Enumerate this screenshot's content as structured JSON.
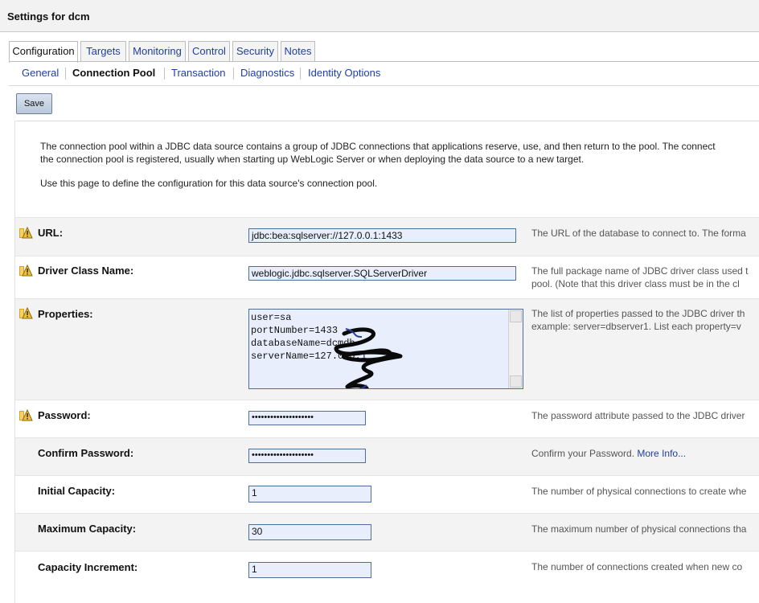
{
  "header": {
    "title": "Settings for dcm"
  },
  "tabs": [
    {
      "label": "Configuration",
      "active": true
    },
    {
      "label": "Targets",
      "active": false
    },
    {
      "label": "Monitoring",
      "active": false
    },
    {
      "label": "Control",
      "active": false
    },
    {
      "label": "Security",
      "active": false
    },
    {
      "label": "Notes",
      "active": false
    }
  ],
  "subtabs": [
    {
      "label": "General",
      "active": false
    },
    {
      "label": "Connection Pool",
      "active": true
    },
    {
      "label": "Transaction",
      "active": false
    },
    {
      "label": "Diagnostics",
      "active": false
    },
    {
      "label": "Identity Options",
      "active": false
    }
  ],
  "toolbar": {
    "save_label": "Save"
  },
  "intro": {
    "line1": "The connection pool within a JDBC data source contains a group of JDBC connections that applications reserve, use, and then return to the pool. The connect",
    "line2": "the connection pool is registered, usually when starting up WebLogic Server or when deploying the data source to a new target.",
    "line3": "Use this page to define the configuration for this data source's connection pool."
  },
  "fields": {
    "url": {
      "label": "URL:",
      "value": "jdbc:bea:sqlserver://127.0.0.1:1433",
      "desc": "The URL of the database to connect to. The forma"
    },
    "driver": {
      "label": "Driver Class Name:",
      "value": "weblogic.jdbc.sqlserver.SQLServerDriver",
      "desc1": "The full package name of JDBC driver class used t",
      "desc2": "pool. (Note that this driver class must be in the cl"
    },
    "properties": {
      "label": "Properties:",
      "lines": "user=sa\nportNumber=1433\ndatabaseName=dcmdb\nserverName=127.0.0.1",
      "desc1": "The list of properties passed to the JDBC driver th",
      "desc2": "example: server=dbserver1. List each property=v"
    },
    "password": {
      "label": "Password:",
      "value": "••••••••••••••••••••",
      "desc": "The password attribute passed to the JDBC driver"
    },
    "confirm_password": {
      "label": "Confirm Password:",
      "value": "••••••••••••••••••••",
      "desc": "Confirm your Password.",
      "link": "More Info..."
    },
    "initial_capacity": {
      "label": "Initial Capacity:",
      "value": "1",
      "desc": "The number of physical connections to create whe"
    },
    "maximum_capacity": {
      "label": "Maximum Capacity:",
      "value": "30",
      "desc": "The maximum number of physical connections tha"
    },
    "capacity_increment": {
      "label": "Capacity Increment:",
      "value": "1",
      "desc": "The number of connections created when new co"
    }
  }
}
